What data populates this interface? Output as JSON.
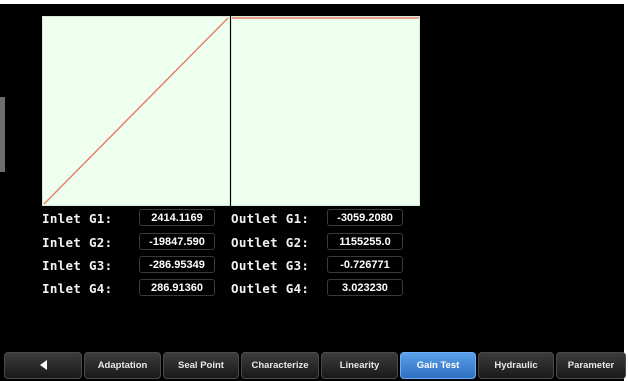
{
  "readout": {
    "inlet": [
      {
        "label": "Inlet G1:",
        "value": "2414.1169"
      },
      {
        "label": "Inlet G2:",
        "value": "-19847.590"
      },
      {
        "label": "Inlet G3:",
        "value": "-286.95349"
      },
      {
        "label": "Inlet G4:",
        "value": "286.91360"
      }
    ],
    "outlet": [
      {
        "label": "Outlet G1:",
        "value": "-3059.2080"
      },
      {
        "label": "Outlet G2:",
        "value": "1155255.0"
      },
      {
        "label": "Outlet G3:",
        "value": "-0.726771"
      },
      {
        "label": "Outlet G4:",
        "value": "3.023230"
      }
    ]
  },
  "tabs": [
    {
      "label": "",
      "icon": "back-arrow-icon"
    },
    {
      "label": "Adaptation"
    },
    {
      "label": "Seal Point"
    },
    {
      "label": "Characterize"
    },
    {
      "label": "Linearity"
    },
    {
      "label": "Gain Test",
      "active": true
    },
    {
      "label": "Hydraulic"
    },
    {
      "label": "Parameter"
    }
  ],
  "colors": {
    "plot_background": "#efffef",
    "trace": "#e8806a",
    "active_tab": "#3f86d8",
    "tab": "#2a2a2a"
  }
}
